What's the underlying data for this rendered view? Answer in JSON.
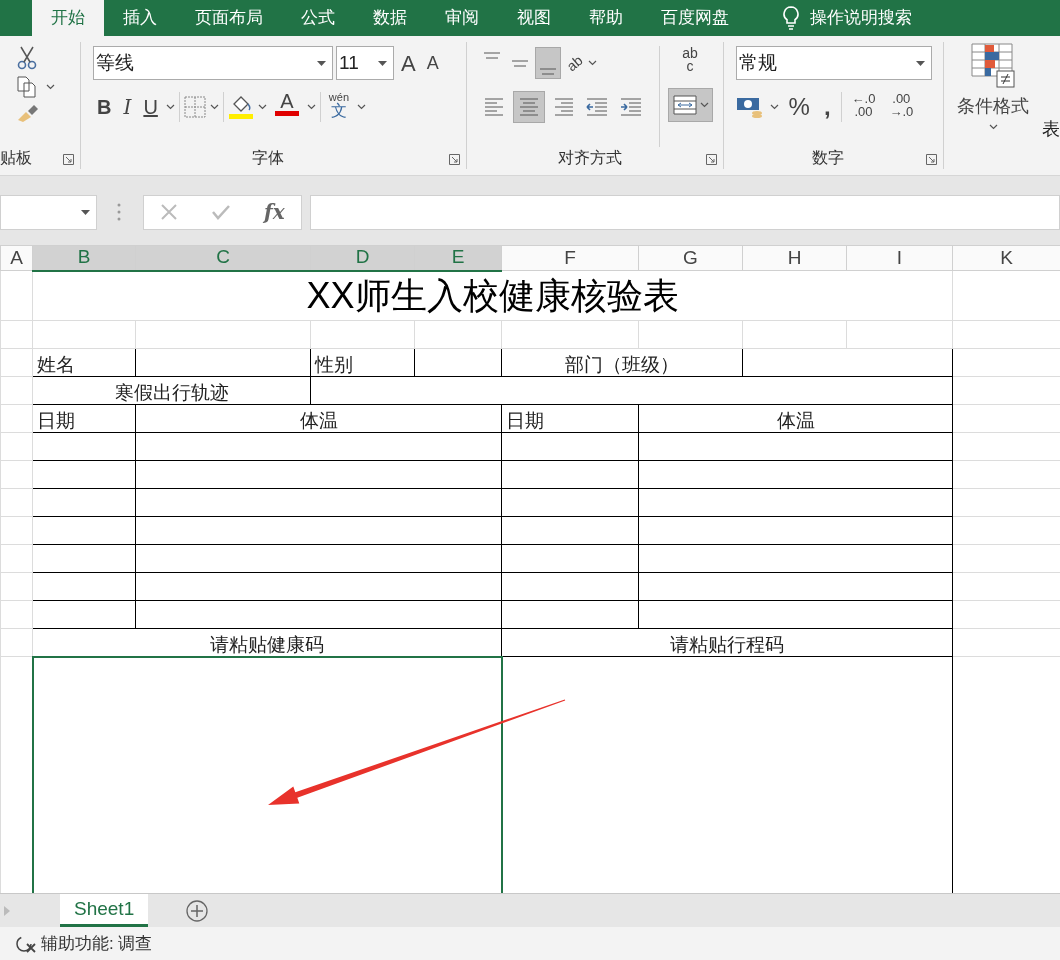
{
  "ribbon_tabs": [
    {
      "label": "开始",
      "selected": true
    },
    {
      "label": "插入",
      "selected": false
    },
    {
      "label": "页面布局",
      "selected": false
    },
    {
      "label": "公式",
      "selected": false
    },
    {
      "label": "数据",
      "selected": false
    },
    {
      "label": "审阅",
      "selected": false
    },
    {
      "label": "视图",
      "selected": false
    },
    {
      "label": "帮助",
      "selected": false
    },
    {
      "label": "百度网盘",
      "selected": false
    }
  ],
  "tell_me": "操作说明搜索",
  "clipboard": {
    "label": "贴板"
  },
  "font": {
    "name": "等线",
    "size": "11",
    "grow": "A",
    "shrink": "A",
    "bold": "B",
    "italic": "I",
    "underline": "U",
    "font_color": "A",
    "phonetic_top": "wén",
    "phonetic": "文",
    "label": "字体"
  },
  "alignment": {
    "vertical": [
      {
        "selected": false
      },
      {
        "selected": false
      },
      {
        "selected": true
      }
    ],
    "orientation": "ab",
    "horizontal": [
      {
        "kind": "left",
        "selected": false
      },
      {
        "kind": "center",
        "selected": true
      },
      {
        "kind": "right",
        "selected": false
      },
      {
        "kind": "outdent",
        "selected": false
      },
      {
        "kind": "indent",
        "selected": false
      }
    ],
    "wrap": [
      "ab",
      "c"
    ],
    "merge_selected": true,
    "label": "对齐方式"
  },
  "number": {
    "format": "常规",
    "percent": "%",
    "comma": ",",
    "increase_decimal": [
      "←.0",
      ".00"
    ],
    "decrease_decimal": [
      ".00",
      "→.0"
    ],
    "label": "数字"
  },
  "styles": {
    "conditional_format": "条件格式",
    "next_label": "表"
  },
  "formula_bar": {
    "fx": "fx"
  },
  "columns": [
    {
      "label": "A",
      "selected": false
    },
    {
      "label": "B",
      "selected": true
    },
    {
      "label": "C",
      "selected": true
    },
    {
      "label": "D",
      "selected": true
    },
    {
      "label": "E",
      "selected": true
    },
    {
      "label": "F",
      "selected": false
    },
    {
      "label": "G",
      "selected": false
    },
    {
      "label": "H",
      "selected": false
    },
    {
      "label": "I",
      "selected": false
    },
    {
      "label": "K",
      "selected": false
    }
  ],
  "rows": [
    {
      "kind": "title",
      "cells": [
        {
          "text": "XX师生入校健康核验表",
          "selected": false
        }
      ]
    },
    {
      "kind": "blank",
      "cells": [
        {
          "selected": false
        },
        {
          "selected": false
        },
        {
          "selected": false
        },
        {
          "selected": false
        },
        {
          "selected": false
        },
        {
          "selected": false
        },
        {
          "selected": false
        },
        {
          "selected": false
        }
      ]
    },
    {
      "kind": "info",
      "cells": [
        {
          "text": "姓名",
          "selected": false
        },
        {
          "selected": false
        },
        {
          "text": "性别",
          "selected": false
        },
        {
          "selected": false
        },
        {
          "text": "部门（班级）",
          "selected": false
        },
        {
          "selected": false
        }
      ]
    },
    {
      "kind": "trip",
      "cells": [
        {
          "text": "寒假出行轨迹",
          "selected": false
        },
        {
          "selected": false
        }
      ]
    },
    {
      "kind": "log",
      "cells": [
        {
          "text": "日期",
          "selected": false
        },
        {
          "text": "体温",
          "selected": false
        },
        {
          "text": "日期",
          "selected": false
        },
        {
          "text": "体温",
          "selected": false
        }
      ]
    },
    {
      "kind": "log",
      "cells": [
        {
          "selected": false
        },
        {
          "selected": false
        },
        {
          "selected": false
        },
        {
          "selected": false
        }
      ]
    },
    {
      "kind": "log",
      "cells": [
        {
          "selected": false
        },
        {
          "selected": false
        },
        {
          "selected": false
        },
        {
          "selected": false
        }
      ]
    },
    {
      "kind": "log",
      "cells": [
        {
          "selected": false
        },
        {
          "selected": false
        },
        {
          "selected": false
        },
        {
          "selected": false
        }
      ]
    },
    {
      "kind": "log",
      "cells": [
        {
          "selected": false
        },
        {
          "selected": false
        },
        {
          "selected": false
        },
        {
          "selected": false
        }
      ]
    },
    {
      "kind": "log",
      "cells": [
        {
          "selected": false
        },
        {
          "selected": false
        },
        {
          "selected": false
        },
        {
          "selected": false
        }
      ]
    },
    {
      "kind": "log",
      "cells": [
        {
          "selected": false
        },
        {
          "selected": false
        },
        {
          "selected": false
        },
        {
          "selected": false
        }
      ]
    },
    {
      "kind": "log",
      "cells": [
        {
          "selected": false
        },
        {
          "selected": false
        },
        {
          "selected": false
        },
        {
          "selected": false
        }
      ]
    },
    {
      "kind": "codes",
      "cells": [
        {
          "text": "请粘贴健康码",
          "selected": false
        },
        {
          "text": "请粘贴行程码",
          "selected": false
        }
      ]
    },
    {
      "kind": "code_area",
      "cells": [
        {
          "selected": true
        },
        {
          "selected": false
        }
      ]
    }
  ],
  "annotation": {
    "kind": "arrow"
  },
  "sheet_tabs": [
    {
      "label": "Sheet1",
      "selected": true
    }
  ],
  "status": "辅助功能: 调查"
}
